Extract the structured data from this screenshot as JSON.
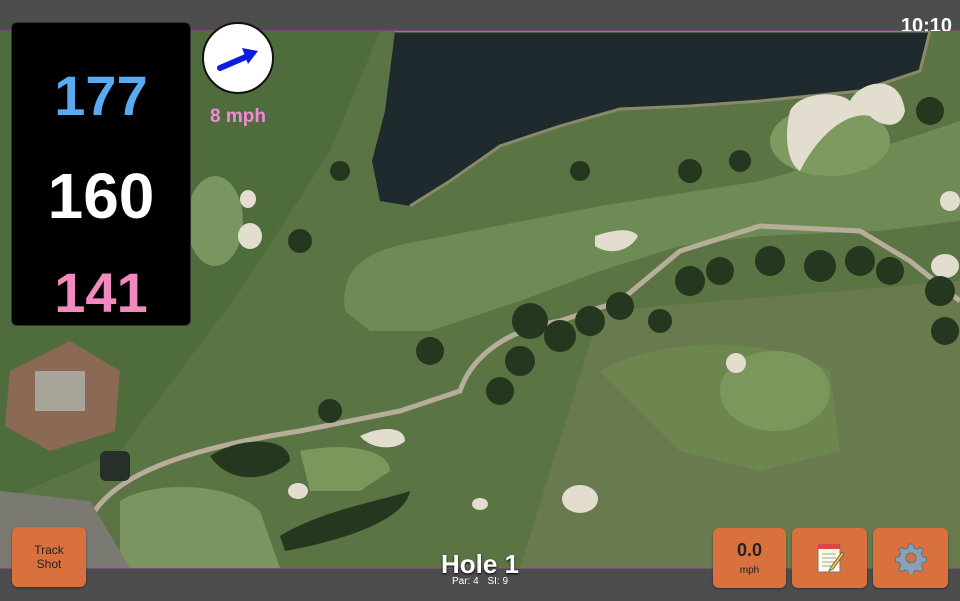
{
  "status": {
    "time": "10:10"
  },
  "distances": {
    "back": "177",
    "middle": "160",
    "front": "141"
  },
  "wind": {
    "speed_label": "8 mph",
    "icon": "arrow-right-icon"
  },
  "buttons": {
    "track_shot": "Track\nShot",
    "speed_value": "0.0",
    "speed_unit": "mph",
    "notes_icon": "notepad-icon",
    "settings_icon": "gear-icon"
  },
  "hole": {
    "title": "Hole 1",
    "par": "Par: 4",
    "si": "SI: 9"
  },
  "colors": {
    "back": "#5aaaf2",
    "middle": "#ffffff",
    "front": "#f28ac0",
    "button": "#d9713f",
    "wind_speed": "#f28ad8"
  }
}
